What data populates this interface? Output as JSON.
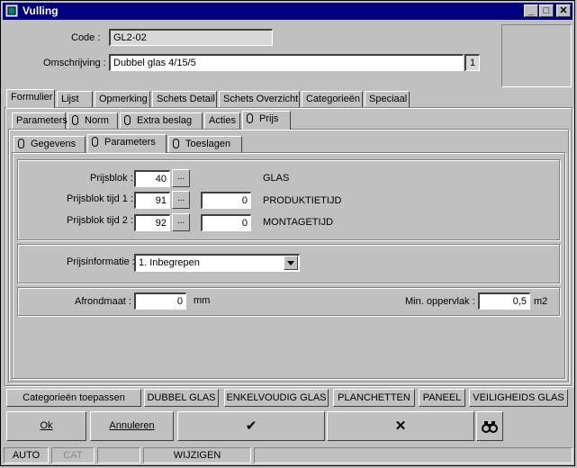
{
  "window": {
    "title": "Vulling"
  },
  "header": {
    "code_label": "Code :",
    "code_value": "GL2-02",
    "omschrijving_label": "Omschrijving :",
    "omschrijving_value": "Dubbel glas 4/15/5",
    "omschrijving_side": "1"
  },
  "main_tabs": [
    "Formulier",
    "Lijst",
    "Opmerking",
    "Schets Detail",
    "Schets Overzicht",
    "Categorieën",
    "Speciaal"
  ],
  "sub_tabs": [
    "Parameters",
    "Norm",
    "Extra beslag",
    "Acties",
    "Prijs"
  ],
  "sub_sub_tabs": [
    "Gegevens",
    "Parameters",
    "Toeslagen"
  ],
  "prijs": {
    "prijsblok_label": "Prijsblok :",
    "prijsblok_value": "40",
    "prijsblok_desc": "GLAS",
    "tijd1_label": "Prijsblok tijd 1 :",
    "tijd1_value": "91",
    "tijd1_amount": "0",
    "tijd1_desc": "PRODUKTIETIJD",
    "tijd2_label": "Prijsblok tijd 2 :",
    "tijd2_value": "92",
    "tijd2_amount": "0",
    "tijd2_desc": "MONTAGETIJD",
    "ellipsis": "..."
  },
  "prijsinfo": {
    "label": "Prijsinformatie :",
    "value": "1.  Inbegrepen"
  },
  "afrond": {
    "label": "Afrondmaat :",
    "value": "0",
    "unit": "mm",
    "min_label": "Min. oppervlak :",
    "min_value": "0,5",
    "min_unit": "m2"
  },
  "categories": [
    "Categorieën toepassen",
    "DUBBEL GLAS",
    "ENKELVOUDIG GLAS",
    "PLANCHETTEN",
    "PANEEL",
    "VEILIGHEIDS GLAS"
  ],
  "actions": {
    "ok": "Ok",
    "annuleren": "Annuleren",
    "confirm_glyph": "✔",
    "cancel_glyph": "✕"
  },
  "statusbar": [
    "AUTO",
    "CAT",
    "",
    "WIJZIGEN",
    ""
  ]
}
